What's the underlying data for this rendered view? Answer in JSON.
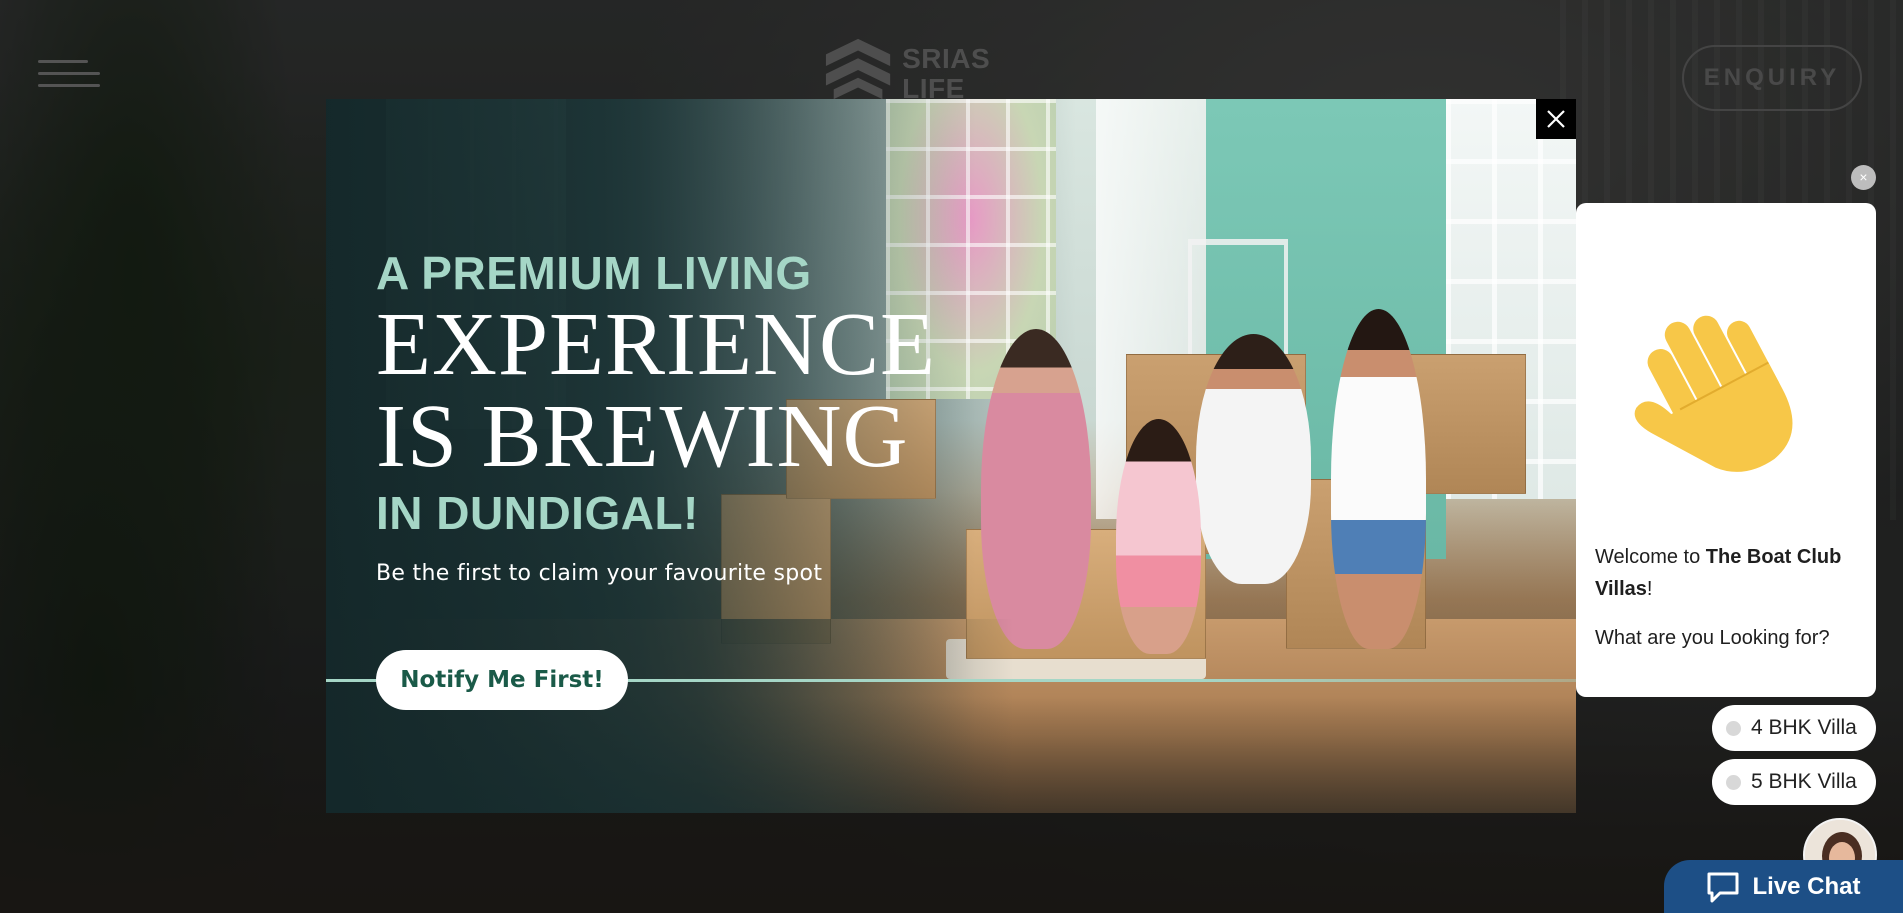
{
  "header": {
    "logo_line1": "SRIAS",
    "logo_line2": "LIFE SPACES",
    "enquiry_label": "ENQUIRY"
  },
  "promo": {
    "headline_top": "A PREMIUM LIVING",
    "headline_mid1": "EXPERIENCE",
    "headline_mid2": "IS BREWING",
    "headline_bottom": "IN DUNDIGAL!",
    "subtitle": "Be the first to claim your favourite spot",
    "cta_label": "Notify Me First!",
    "accent_color": "#a5d6c6",
    "cta_text_color": "#1a5a48"
  },
  "chat": {
    "welcome_prefix": "Welcome to ",
    "welcome_name": "The Boat Club Villas",
    "welcome_suffix": "!",
    "question": "What are you Looking for?",
    "options": [
      {
        "label": "4 BHK Villa"
      },
      {
        "label": "5 BHK Villa"
      }
    ],
    "live_chat_label": "Live Chat",
    "live_chat_color": "#1d4f86",
    "dismiss_label": "×"
  },
  "icons": {
    "menu": "hamburger-icon",
    "close": "close-icon",
    "wave": "waving-hand-icon",
    "chat": "chat-bubble-icon",
    "agent": "agent-avatar"
  }
}
